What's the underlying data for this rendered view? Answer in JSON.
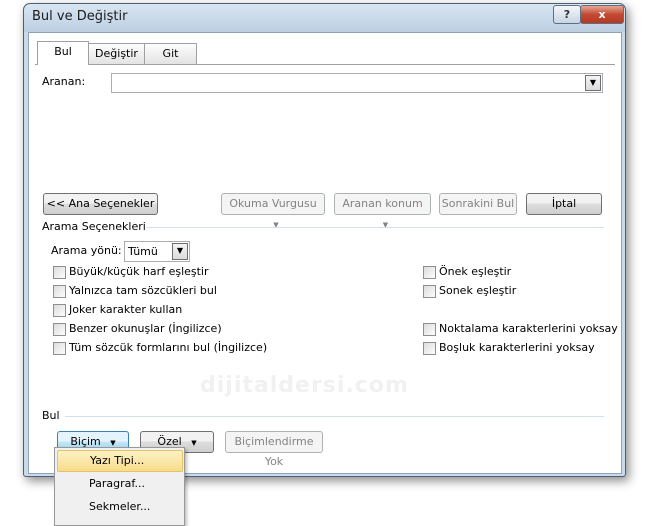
{
  "window": {
    "title": "Bul ve Değiştir",
    "help_label": "?",
    "close_label": "x"
  },
  "tabs": [
    {
      "label": "Bul",
      "active": true
    },
    {
      "label": "Değiştir",
      "active": false
    },
    {
      "label": "Git",
      "active": false
    }
  ],
  "search": {
    "label": "Aranan:",
    "value": ""
  },
  "buttons": {
    "less_options": "<< Ana Seçenekler",
    "reading_highlight": "Okuma Vurgusu",
    "find_in": "Aranan konum",
    "find_next": "Sonrakini Bul",
    "cancel": "İptal"
  },
  "options": {
    "section_title": "Arama Seçenekleri",
    "direction_label": "Arama yönü:",
    "direction_value": "Tümü",
    "left_checks": [
      "Büyük/küçük harf eşleştir",
      "Yalnızca tam sözcükleri bul",
      "Joker karakter kullan",
      "Benzer okunuşlar (İngilizce)",
      "Tüm sözcük formlarını bul (İngilizce)"
    ],
    "right_checks": [
      "Önek eşleştir",
      "Sonek eşleştir",
      "Noktalama karakterlerini yoksay",
      "Boşluk karakterlerini yoksay"
    ]
  },
  "find_section": {
    "title": "Bul",
    "format_button": "Biçim",
    "special_button": "Özel",
    "no_formatting_button": "Biçimlendirme Yok"
  },
  "format_menu": [
    {
      "label": "Yazı Tipi...",
      "highlighted": true
    },
    {
      "label": "Paragraf...",
      "highlighted": false
    },
    {
      "label": "Sekmeler...",
      "highlighted": false
    }
  ],
  "watermark": "dijitaldersi.com",
  "colors": {
    "title_bar": "#bccfe3",
    "close_button": "#c24a33",
    "menu_highlight": "#f8dd8b"
  }
}
